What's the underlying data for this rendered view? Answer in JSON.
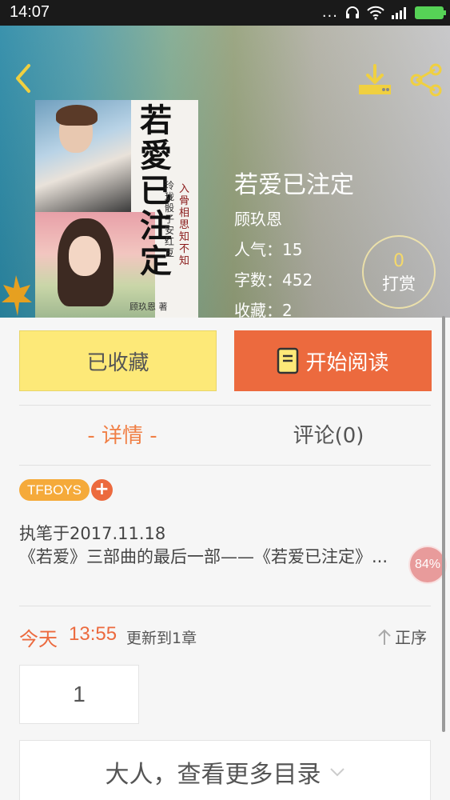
{
  "status_bar": {
    "time": "14:07",
    "dots": "...",
    "icons": [
      "headset-icon",
      "wifi-icon",
      "signal-icon",
      "battery-icon"
    ],
    "battery_color": "#56d256"
  },
  "header": {
    "back_icon": "chevron-left-icon",
    "download_icon": "download-icon",
    "share_icon": "share-icon"
  },
  "book": {
    "cover": {
      "calligraphy_title": "若愛\n已\n注\n定",
      "subtitle_line1": "入骨相思知不知",
      "subtitle_line2": "玲珑骰子安红豆",
      "signature": "顾玖恩 著"
    },
    "title": "若爱已注定",
    "author": "顾玖恩",
    "popularity": "人气：15",
    "word_count": "字数：452",
    "favorites": "收藏：2",
    "tip": {
      "count": "0",
      "label": "打赏"
    }
  },
  "actions": {
    "collected_label": "已收藏",
    "read_label": "开始阅读",
    "read_icon": "book-icon"
  },
  "tabs": [
    {
      "label": "- 详情 -",
      "active": true
    },
    {
      "label": "评论(0)",
      "active": false
    }
  ],
  "tags": [
    "TFBOYS"
  ],
  "tag_add_label": "+",
  "intro": {
    "line1": "执笔于2017.11.18",
    "line2": "《若爱》三部曲的最后一部——《若爱已注定》..."
  },
  "progress_badge": "84%",
  "update": {
    "day": "今天",
    "time": "13:55",
    "info": "更新到1章"
  },
  "sort": {
    "label": "正序",
    "icon": "arrow-up-icon"
  },
  "chapter_number": "1",
  "more_catalog": {
    "label": "大人，查看更多目录",
    "icon": "chevron-down-icon"
  },
  "colors": {
    "accent_orange": "#ec6a3e",
    "collected_yellow": "#fde978",
    "tag_orange": "#f5aa3a",
    "tab_active": "#f07f45"
  }
}
